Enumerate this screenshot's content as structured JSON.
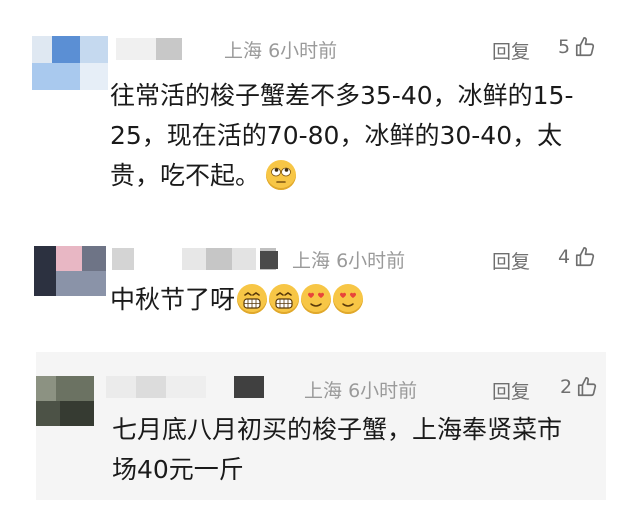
{
  "comments": [
    {
      "location": "上海",
      "time": "6小时前",
      "reply_label": "回复",
      "like_count": "5",
      "text_lines": [
        "往常活的梭子蟹差不多35-40，冰鲜的15-",
        "25，现在活的70-80，冰鲜的30-40，太",
        "贵，吃不起。"
      ],
      "emojis": [
        "rolling-eyes-emoji"
      ]
    },
    {
      "location": "上海",
      "time": "6小时前",
      "reply_label": "回复",
      "like_count": "4",
      "text_lines": [
        "中秋节了呀"
      ],
      "emojis": [
        "grin-emoji",
        "grin-emoji",
        "heart-eyes-emoji",
        "heart-eyes-emoji"
      ]
    },
    {
      "location": "上海",
      "time": "6小时前",
      "reply_label": "回复",
      "like_count": "2",
      "text_lines": [
        "七月底八月初买的梭子蟹，上海奉贤菜市",
        "场40元一斤"
      ],
      "emojis": []
    }
  ],
  "colors": {
    "text": "#1a1a1a",
    "meta": "#9a9a9a",
    "action": "#6f6f6f",
    "emoji": "#f7c646"
  }
}
